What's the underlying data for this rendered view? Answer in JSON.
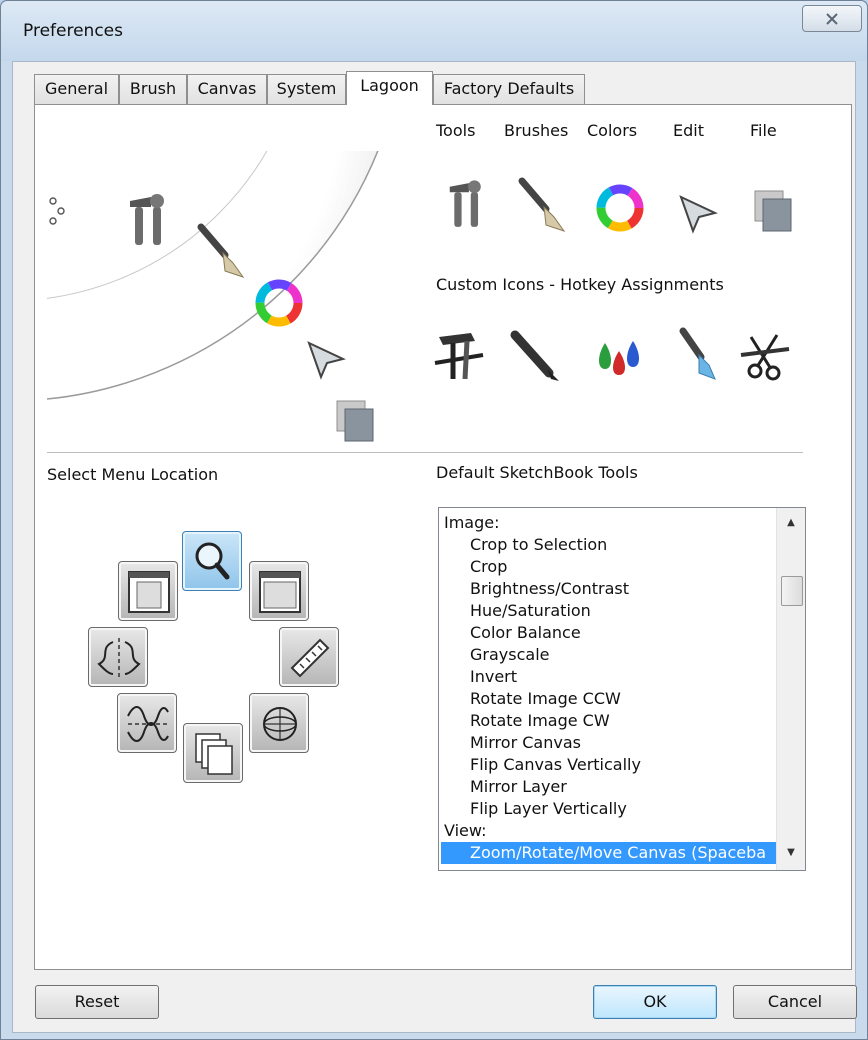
{
  "window": {
    "title": "Preferences",
    "close_icon": "close-icon"
  },
  "tabs": [
    {
      "label": "General",
      "active": false
    },
    {
      "label": "Brush",
      "active": false
    },
    {
      "label": "Canvas",
      "active": false
    },
    {
      "label": "System",
      "active": false
    },
    {
      "label": "Lagoon",
      "active": true
    },
    {
      "label": "Factory Defaults",
      "active": false
    }
  ],
  "lagoon": {
    "categories": [
      {
        "label": "Tools",
        "icon": "tools-icon"
      },
      {
        "label": "Brushes",
        "icon": "brush-icon"
      },
      {
        "label": "Colors",
        "icon": "color-wheel-icon"
      },
      {
        "label": "Edit",
        "icon": "cursor-arrow-icon"
      },
      {
        "label": "File",
        "icon": "file-layers-icon"
      }
    ],
    "custom_heading": "Custom Icons - Hotkey Assignments",
    "custom_icons": [
      "hammer-wrench-icon",
      "pencil-icon",
      "color-drops-icon",
      "paint-brush-icon",
      "scissors-wrench-icon"
    ],
    "select_location_label": "Select Menu Location",
    "default_tools_label": "Default SketchBook Tools",
    "location_icons": [
      "magnifier-icon",
      "window-left-icon",
      "window-top-icon",
      "symmetry-icon",
      "ruler-icon",
      "wave-icon",
      "ellipse-guide-icon",
      "layers-stack-icon"
    ]
  },
  "tools_list": {
    "items": [
      {
        "text": "Image:",
        "group": true
      },
      {
        "text": "Crop to Selection"
      },
      {
        "text": "Crop"
      },
      {
        "text": "Brightness/Contrast"
      },
      {
        "text": "Hue/Saturation"
      },
      {
        "text": "Color Balance"
      },
      {
        "text": "Grayscale"
      },
      {
        "text": "Invert"
      },
      {
        "text": "Rotate Image CCW"
      },
      {
        "text": "Rotate Image CW"
      },
      {
        "text": "Mirror Canvas"
      },
      {
        "text": "Flip Canvas Vertically"
      },
      {
        "text": "Mirror Layer"
      },
      {
        "text": "Flip Layer Vertically"
      },
      {
        "text": "View:",
        "group": true
      },
      {
        "text": "Zoom/Rotate/Move Canvas (Spaceba",
        "selected": true
      }
    ]
  },
  "buttons": {
    "reset": "Reset",
    "ok": "OK",
    "cancel": "Cancel"
  },
  "colors": {
    "selection": "#3399ff",
    "selected_location": "#8fc4ea"
  }
}
